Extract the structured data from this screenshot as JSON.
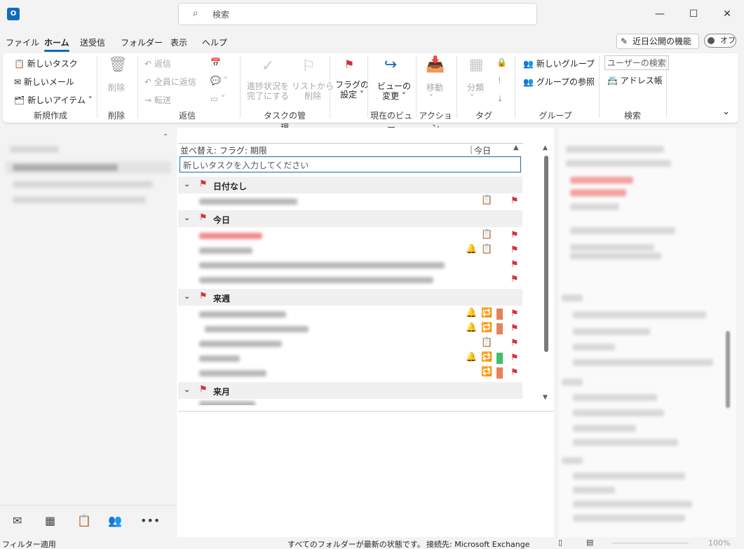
{
  "window": {
    "app_icon_letter": "O",
    "search_placeholder": "検索",
    "minimize": "—",
    "maximize": "☐",
    "close": "✕"
  },
  "menu": {
    "items": [
      "ファイル",
      "ホーム",
      "送受信",
      "フォルダー",
      "表示",
      "ヘルプ"
    ],
    "active": "ホーム",
    "feature_button": "近日公開の機能",
    "toggle_label": "オフ"
  },
  "ribbon": {
    "new": {
      "task": "新しいタスク",
      "mail": "新しいメール",
      "item": "新しいアイテム",
      "group": "新規作成"
    },
    "delete": {
      "label": "削除",
      "group": "削除"
    },
    "reply": {
      "reply": "返信",
      "reply_all": "全員に返信",
      "forward": "転送",
      "group": "返信"
    },
    "task_mgmt": {
      "mark_complete_1": "進捗状況を",
      "mark_complete_2": "完了にする",
      "remove_1": "リストから",
      "remove_2": "削除",
      "group": "タスクの管理"
    },
    "flag": {
      "label_1": "フラグの",
      "label_2": "設定"
    },
    "view": {
      "label_1": "ビューの",
      "label_2": "変更",
      "group": "現在のビュー"
    },
    "move": {
      "label": "移動",
      "group": "アクション"
    },
    "tags": {
      "label": "分類",
      "group": "タグ"
    },
    "groups": {
      "new": "新しいグループ",
      "browse": "グループの参照",
      "group": "グループ"
    },
    "find": {
      "search_people": "ユーザーの検索",
      "address_book": "アドレス帳",
      "group": "検索"
    }
  },
  "tasklist": {
    "sort_label": "並べ替え: フラグ: 期限",
    "sort_column": "今日",
    "new_task_placeholder": "新しいタスクを入力してください",
    "groups": [
      {
        "label": "日付なし"
      },
      {
        "label": "今日"
      },
      {
        "label": "来週"
      },
      {
        "label": "来月"
      }
    ]
  },
  "colors": {
    "accent": "#0f6cbd",
    "flag_red": "#d13438",
    "cat_orange": "#e8825a",
    "cat_green": "#3fc06b"
  },
  "status": {
    "filter": "フィルター適用",
    "sync": "すべてのフォルダーが最新の状態です。",
    "connection": "接続先: Microsoft Exchange",
    "zoom": "100%"
  }
}
